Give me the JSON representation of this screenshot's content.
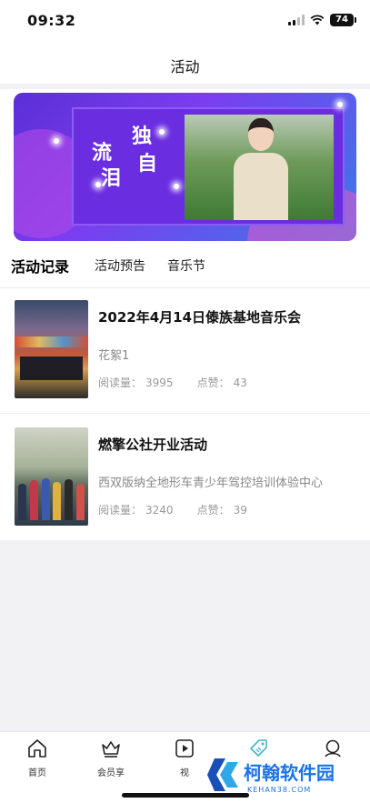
{
  "status_bar": {
    "time": "09:32",
    "battery": "74"
  },
  "nav": {
    "title": "活动"
  },
  "banner": {
    "title_chars": [
      "独",
      "流",
      "自",
      "泪"
    ]
  },
  "tabs": [
    {
      "label": "活动记录",
      "active": true
    },
    {
      "label": "活动预告",
      "active": false
    },
    {
      "label": "音乐节",
      "active": false
    }
  ],
  "activities": [
    {
      "title": "2022年4月14日傣族基地音乐会",
      "subtitle": "花絮1",
      "reads_label": "阅读量：",
      "reads": "3995",
      "likes_label": "点赞：",
      "likes": "43"
    },
    {
      "title": "燃擎公社开业活动",
      "subtitle": "西双版纳全地形车青少年驾控培训体验中心",
      "reads_label": "阅读量：",
      "reads": "3240",
      "likes_label": "点赞：",
      "likes": "39"
    }
  ],
  "bottom_nav": [
    {
      "label": "首页",
      "icon": "home-icon"
    },
    {
      "label": "会员享",
      "icon": "crown-icon"
    },
    {
      "label": "视",
      "icon": "play-icon"
    },
    {
      "label": "",
      "icon": "tag-icon"
    },
    {
      "label": "",
      "icon": "profile-icon"
    }
  ],
  "watermark": {
    "text": "柯翰软件园",
    "sub": "KEHAN38.COM"
  }
}
